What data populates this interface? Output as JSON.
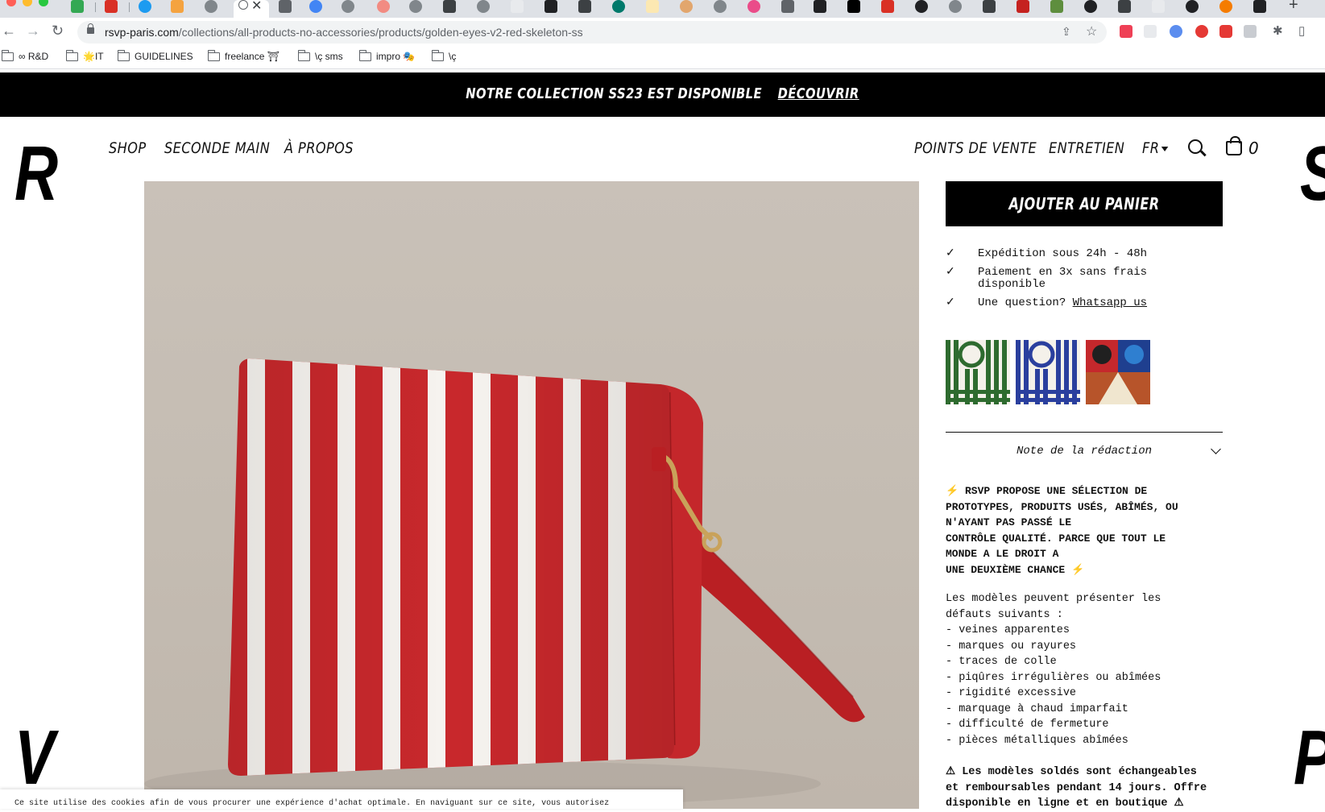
{
  "browser": {
    "url_host": "rsvp-paris.com",
    "url_path": "/collections/all-products-no-accessories/products/golden-eyes-v2-red-skeleton-ss",
    "bookmarks": [
      "∞ R&D",
      "🌟IT",
      "GUIDELINES",
      "freelance ⛩",
      "\\ç sms",
      "impro 🎭",
      "\\ç"
    ],
    "new_tab": "+",
    "close_tab": "✕"
  },
  "announcement": {
    "text": "NOTRE COLLECTION SS23 EST DISPONIBLE",
    "link": "DÉCOUVRIR"
  },
  "header": {
    "logo_left_top": "R",
    "logo_left_bottom": "V",
    "logo_right_top": "S",
    "logo_right_bottom": "P",
    "nav_left": [
      "SHOP",
      "SECONDE MAIN",
      "À PROPOS"
    ],
    "nav_right": [
      "POINTS DE VENTE",
      "ENTRETIEN",
      "FR"
    ],
    "cart_count": "0"
  },
  "product": {
    "add_to_cart": "AJOUTER AU PANIER",
    "features": [
      {
        "text": "Expédition sous 24h - 48h"
      },
      {
        "text": "Paiement en 3x sans frais disponible"
      },
      {
        "text": "Une question? ",
        "link": "Whatsapp us"
      }
    ],
    "tick": "✓",
    "note_title": "Note de la rédaction",
    "bold_intro_lines": [
      "⚡ RSVP PROPOSE UNE SÉLECTION DE",
      "PROTOTYPES, PRODUITS USÉS, ABÎMÉS, OU",
      "N'AYANT PAS PASSÉ LE",
      "CONTRÔLE QUALITÉ. PARCE QUE TOUT LE",
      "MONDE A LE DROIT A",
      "UNE DEUXIÈME CHANCE ⚡"
    ],
    "defects_lines": [
      "Les modèles peuvent présenter les",
      "défauts suivants :",
      "- veines apparentes",
      "- marques ou rayures",
      "- traces de colle",
      "- piqûres irrégulières ou abîmées",
      "- rigidité excessive",
      "- marquage à chaud imparfait",
      "- difficulté de fermeture",
      "- pièces métalliques abîmées"
    ],
    "warning_lines": [
      "⚠ Les modèles soldés sont échangeables",
      "et remboursables pendant 14 jours. Offre",
      "disponible en ligne et en boutique ⚠"
    ]
  },
  "cookie": {
    "text": "Ce site utilise des cookies afin de vous procurer une expérience d'achat optimale. En naviguant sur ce site, vous autorisez"
  },
  "colors": {
    "announcement_bg": "#000000",
    "bag_red": "#c8282c",
    "backdrop": "#c6beb4",
    "accent_bolt": "#f5b400"
  },
  "icons": [
    "back-icon",
    "forward-icon",
    "reload-icon",
    "lock-icon",
    "share-icon",
    "star-icon",
    "search-icon",
    "cart-icon",
    "chevron-down-icon",
    "checkmark-icon",
    "lightning-icon",
    "warning-icon"
  ]
}
